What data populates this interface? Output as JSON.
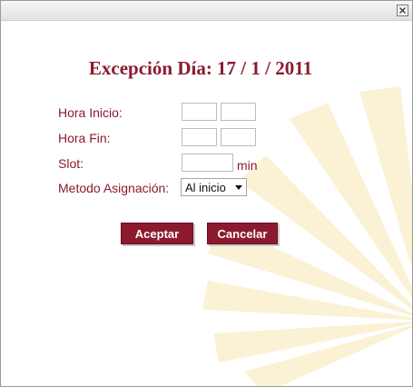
{
  "dialog": {
    "close_icon": "close-x-icon",
    "heading": "Excepción Día: 17 / 1 / 2011"
  },
  "form": {
    "hora_inicio_label": "Hora Inicio:",
    "hora_inicio_hours": "",
    "hora_inicio_minutes": "",
    "hora_fin_label": "Hora Fin:",
    "hora_fin_hours": "",
    "hora_fin_minutes": "",
    "slot_label": "Slot:",
    "slot_value": "",
    "slot_unit": "min",
    "metodo_label": "Metodo Asignación:",
    "metodo_selected": "Al inicio"
  },
  "buttons": {
    "accept": "Aceptar",
    "cancel": "Cancelar"
  },
  "colors": {
    "accent": "#8b1a2e",
    "watermark": "#fbf1d4"
  }
}
